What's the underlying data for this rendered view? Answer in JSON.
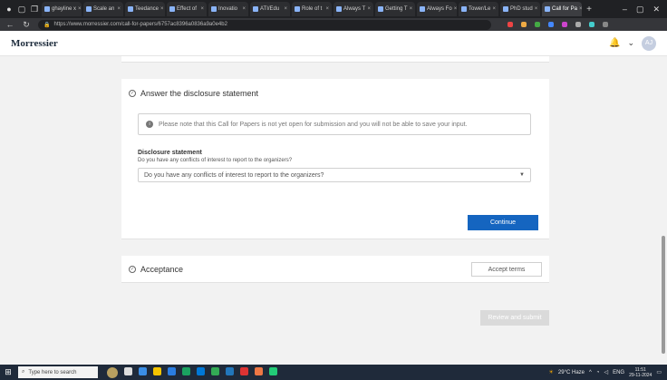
{
  "browser": {
    "tabs": [
      {
        "label": "ghayline x"
      },
      {
        "label": "Scale an"
      },
      {
        "label": "Teedance"
      },
      {
        "label": "Effect of"
      },
      {
        "label": "Inovatio"
      },
      {
        "label": "ATI/Edu"
      },
      {
        "label": "Role of t"
      },
      {
        "label": "Always T"
      },
      {
        "label": "Getting T"
      },
      {
        "label": "Always Fo"
      },
      {
        "label": "Tower/Le"
      },
      {
        "label": "PhD stud"
      },
      {
        "label": "Call for Pa",
        "active": true
      }
    ],
    "url": "https://www.morressier.com/call-for-papers/6757ac8396a0836a9a0e4b2"
  },
  "app": {
    "logo": "Morressier",
    "avatar": "AJ"
  },
  "disclosure": {
    "title": "Answer the disclosure statement",
    "notice": "Please note that this Call for Papers is not yet open for submission and you will not be able to save your input.",
    "label": "Disclosure statement",
    "sublabel": "Do you have any conflicts of interest to report to the organizers?",
    "select_value": "Do you have any conflicts of interest to report to the organizers?",
    "continue_label": "Continue"
  },
  "acceptance": {
    "title": "Acceptance",
    "button_label": "Accept terms"
  },
  "review": {
    "button_label": "Review and submit"
  },
  "taskbar": {
    "search_placeholder": "Type here to search",
    "weather": "29°C Haze",
    "lang": "ENG",
    "time": "11:51",
    "date": "29-11-2024"
  },
  "colors": {
    "accent": "#1565c0",
    "disabled": "#dadada"
  }
}
